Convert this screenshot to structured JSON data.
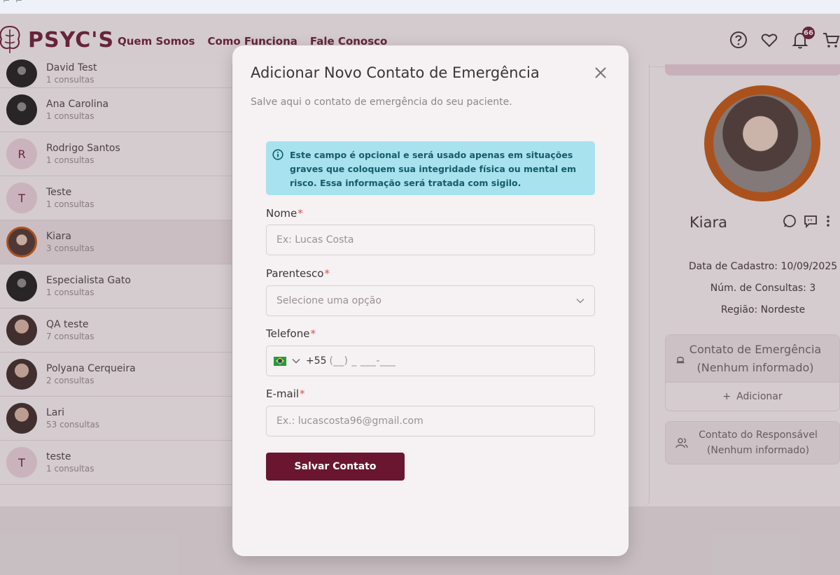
{
  "header": {
    "brand": "PSYC'S",
    "nav": [
      "Quem Somos",
      "Como Funciona",
      "Fale Conosco"
    ],
    "notification_count": "66"
  },
  "patients": [
    {
      "name": "David Test",
      "count": "1 consultas"
    },
    {
      "name": "Ana Carolina",
      "count": "1 consultas"
    },
    {
      "name": "Rodrigo Santos",
      "count": "1 consultas",
      "initial": "R"
    },
    {
      "name": "Teste",
      "count": "1 consultas",
      "initial": "T"
    },
    {
      "name": "Kiara",
      "count": "3 consultas"
    },
    {
      "name": "Especialista Gato",
      "count": "1 consultas"
    },
    {
      "name": "QA teste",
      "count": "7 consultas"
    },
    {
      "name": "Polyana Cerqueira",
      "count": "2 consultas"
    },
    {
      "name": "Lari",
      "count": "53 consultas"
    },
    {
      "name": "teste",
      "count": "1 consultas",
      "initial": "T"
    }
  ],
  "profile": {
    "name": "Kiara",
    "registration": "Data de Cadastro: 10/09/2025",
    "consult_count": "Núm. de Consultas: 3",
    "region": "Região: Nordeste",
    "emergency_title": "Contato de Emergência",
    "emergency_status": "(Nenhum informado)",
    "add_label": "Adicionar",
    "responsible_title": "Contato do Responsável",
    "responsible_status": "(Nenhum informado)"
  },
  "modal": {
    "title": "Adicionar Novo Contato de Emergência",
    "subtitle": "Salve aqui o contato de emergência do seu paciente.",
    "info": "Este campo é opcional e será usado apenas em situações graves que coloquem sua integridade física ou mental em risco. Essa informação será tratada com sigilo.",
    "name_label": "Nome",
    "name_placeholder": "Ex: Lucas Costa",
    "relation_label": "Parentesco",
    "relation_placeholder": "Selecione uma opção",
    "phone_label": "Telefone",
    "phone_code": "+55",
    "phone_mask": "(__) _ ___-___",
    "email_label": "E-mail",
    "email_placeholder": "Ex.: lucascosta96@gmail.com",
    "required_mark": "*",
    "save_label": "Salvar Contato"
  },
  "colors": {
    "brand": "#6a1b35",
    "button": "#6a1631",
    "info_bg": "#a8e2ef",
    "info_text": "#145b6b",
    "profile_ring": "#c2570f"
  }
}
